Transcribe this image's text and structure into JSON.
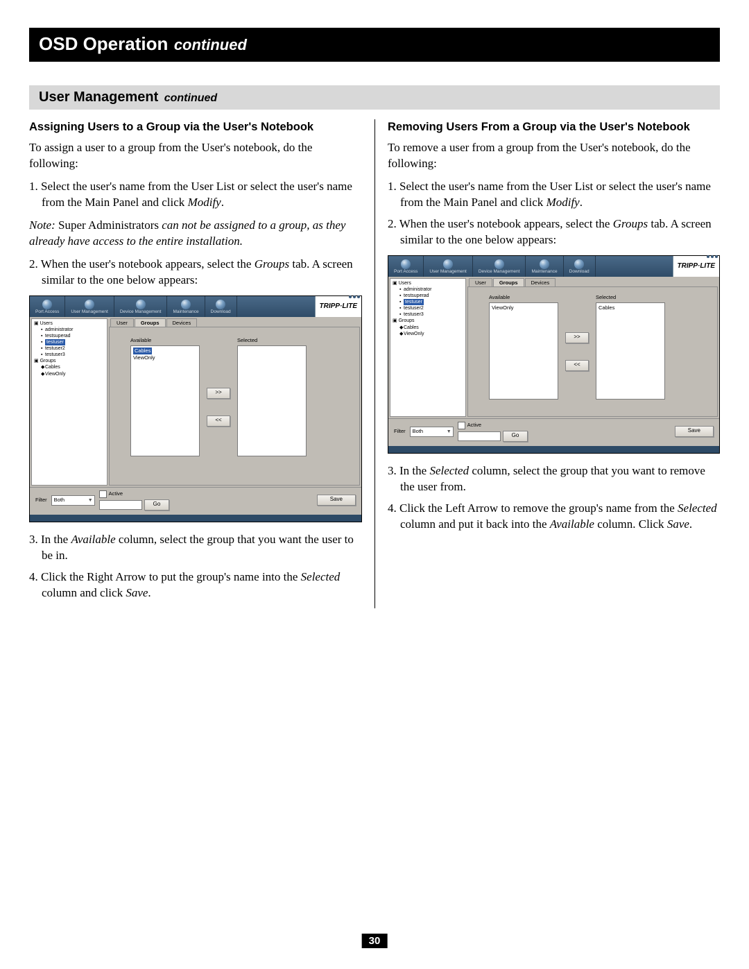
{
  "header": {
    "title": "OSD Operation",
    "continued": "continued"
  },
  "subheader": {
    "title": "User Management",
    "continued": "continued"
  },
  "page_number": "30",
  "left": {
    "heading": "Assigning Users to a Group via the User's Notebook",
    "intro": "To assign a user to a group from the User's notebook, do the following:",
    "step1_a": "1. Select the user's name from the User List or select the user's name from the Main Panel and click ",
    "step1_modify": "Modify",
    "step1_b": ".",
    "note_label": "Note:",
    "note_a": " Super Administrators ",
    "note_b": "can not be assigned to a group, as they already have access to the entire installation.",
    "step2_a": "2. When the user's notebook appears, select the ",
    "step2_groups": "Groups",
    "step2_b": " tab. A screen similar to the one below appears:",
    "step3_a": "3. In the ",
    "step3_available": "Available",
    "step3_b": " column, select the group that you want the user to be in.",
    "step4_a": "4. Click the Right Arrow to put the group's name into the ",
    "step4_selected": "Selected",
    "step4_b": " column and click ",
    "step4_save": "Save",
    "step4_c": "."
  },
  "right": {
    "heading": "Removing Users From a Group via the User's Notebook",
    "intro": "To remove a user from a group from the User's notebook, do the following:",
    "step1_a": "1. Select the user's name from the User List or select the user's name from the Main Panel and click ",
    "step1_modify": "Modify",
    "step1_b": ".",
    "step2_a": "2. When the user's notebook appears, select the ",
    "step2_groups": "Groups",
    "step2_b": " tab. A screen similar to the one below appears:",
    "step3_a": "3. In the ",
    "step3_selected": "Selected",
    "step3_b": " column, select the group that you want to remove the user from.",
    "step4_a": "4. Click the Left Arrow to remove the group's name from the ",
    "step4_selected": "Selected",
    "step4_b": " column and put it back into the ",
    "step4_available": "Available",
    "step4_c": " column. Click ",
    "step4_save": "Save",
    "step4_d": "."
  },
  "screenshot": {
    "brand": "TRIPP·LITE",
    "top_tabs": [
      "Port Access",
      "User Management",
      "Device Management",
      "Maintenance",
      "Download"
    ],
    "tree": {
      "root": "Users",
      "users": [
        "administrator",
        "testsuperad",
        "testuser",
        "testuser2",
        "testuser3"
      ],
      "selected_user_index_left": 2,
      "selected_user_index_right": 2,
      "groups_root": "Groups",
      "groups": [
        "Cables",
        "ViewOnly"
      ]
    },
    "tabs": {
      "items": [
        "User",
        "Groups",
        "Devices"
      ],
      "active_index": 1
    },
    "available_label": "Available",
    "selected_label": "Selected",
    "left_available": [
      "Cables",
      "ViewOnly"
    ],
    "left_available_selected_index": 0,
    "left_selected": [],
    "right_available": [
      "ViewOnly"
    ],
    "right_selected": [
      "Cables"
    ],
    "arrow_right": ">>",
    "arrow_left": "<<",
    "filter": {
      "label": "Filter",
      "select_value": "Both",
      "active_label": "Active",
      "go": "Go",
      "save": "Save"
    }
  }
}
